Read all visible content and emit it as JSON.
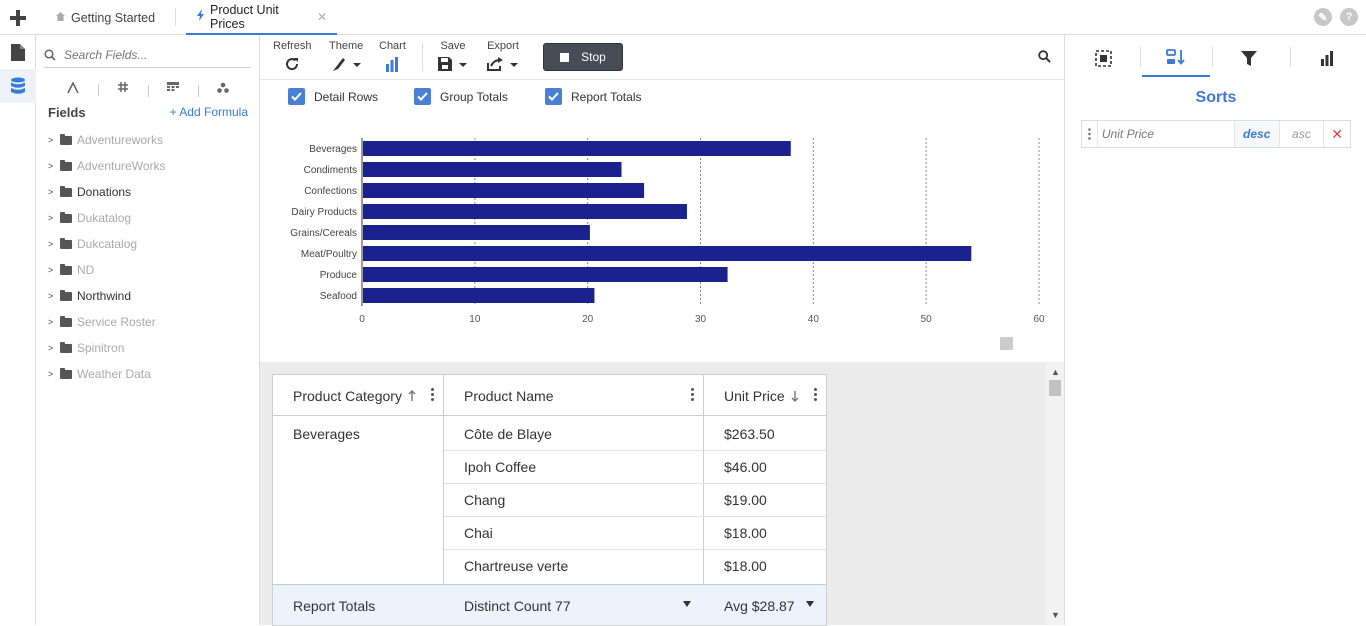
{
  "tabs": [
    {
      "label": "Getting Started",
      "icon": "home-icon"
    },
    {
      "label": "Product Unit Prices",
      "icon": "bolt-icon",
      "active": true
    }
  ],
  "fields_panel": {
    "search_placeholder": "Search Fields...",
    "title": "Fields",
    "add_formula": "+ Add Formula",
    "datasources": [
      {
        "label": "Adventureworks",
        "enabled": false
      },
      {
        "label": "AdventureWorks",
        "enabled": false
      },
      {
        "label": "Donations",
        "enabled": true
      },
      {
        "label": "Dukatalog",
        "enabled": false
      },
      {
        "label": "Dukcatalog",
        "enabled": false
      },
      {
        "label": "ND",
        "enabled": false
      },
      {
        "label": "Northwind",
        "enabled": true
      },
      {
        "label": "Service Roster",
        "enabled": false
      },
      {
        "label": "Spinitron",
        "enabled": false
      },
      {
        "label": "Weather Data",
        "enabled": false
      }
    ]
  },
  "toolbar": {
    "refresh": "Refresh",
    "theme": "Theme",
    "chart": "Chart",
    "save": "Save",
    "export": "Export",
    "stop": "Stop"
  },
  "options": {
    "detail_rows": "Detail Rows",
    "group_totals": "Group Totals",
    "report_totals": "Report Totals"
  },
  "chart_data": {
    "type": "bar",
    "orientation": "horizontal",
    "categories": [
      "Beverages",
      "Condiments",
      "Confections",
      "Dairy Products",
      "Grains/Cereals",
      "Meat/Poultry",
      "Produce",
      "Seafood"
    ],
    "values": [
      38,
      23,
      25,
      28.8,
      20.2,
      54,
      32.4,
      20.6
    ],
    "xticks": [
      0,
      10,
      20,
      30,
      40,
      50,
      60
    ],
    "xlim": [
      0,
      60
    ],
    "grid": true,
    "color": "#1c2190"
  },
  "grid": {
    "columns": [
      {
        "label": "Product Category",
        "sort": "asc"
      },
      {
        "label": "Product Name",
        "sort": ""
      },
      {
        "label": "Unit Price",
        "sort": "desc"
      }
    ],
    "group": "Beverages",
    "rows": [
      {
        "name": "Côte de Blaye",
        "price": "$263.50"
      },
      {
        "name": "Ipoh Coffee",
        "price": "$46.00"
      },
      {
        "name": "Chang",
        "price": "$19.00"
      },
      {
        "name": "Chai",
        "price": "$18.00"
      },
      {
        "name": "Chartreuse verte",
        "price": "$18.00"
      }
    ],
    "totals": {
      "label": "Report Totals",
      "name_total": "Distinct Count 77",
      "price_total": "Avg $28.87"
    }
  },
  "right_panel": {
    "title": "Sorts",
    "sort": {
      "field": "Unit Price",
      "desc": "desc",
      "asc": "asc",
      "active": "desc"
    }
  },
  "colors": {
    "accent": "#3a7bd5",
    "bar": "#1c2190",
    "stop_button": "#474d57"
  }
}
